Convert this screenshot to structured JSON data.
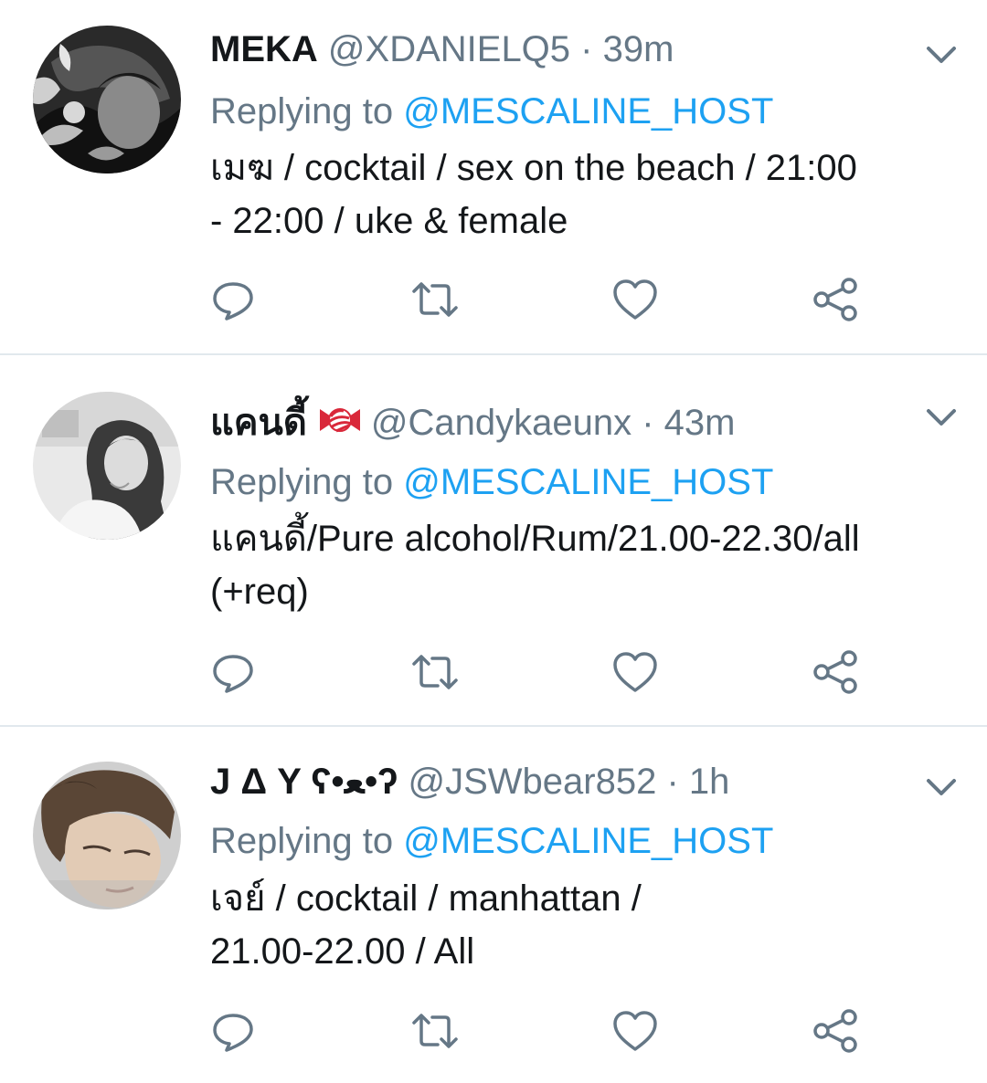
{
  "tweets": [
    {
      "display_name": "MEKA",
      "handle": "@XDANIELQ5",
      "separator": "·",
      "time": "39m",
      "replying_prefix": "Replying to",
      "replying_to": "@MESCALINE_HOST",
      "text_lines": [
        "เมฆ / cocktail / sex on the beach / 21:00",
        "- 22:00 / uke & female"
      ],
      "avatar_icon": "avatar-photo-dark"
    },
    {
      "display_name": "แคนดี้",
      "emoji_icon": "candy-icon",
      "handle": "@Candykaeunx",
      "separator": "·",
      "time": "43m",
      "replying_prefix": "Replying to",
      "replying_to": "@MESCALINE_HOST",
      "text_lines": [
        "แคนดี้/Pure alcohol/Rum/21.00-22.30/all",
        "(+req)"
      ],
      "avatar_icon": "avatar-photo-woman"
    },
    {
      "display_name": "J Δ Y ʕ•ﻌ•ʔ",
      "handle": "@JSWbear852",
      "separator": "·",
      "time": "1h",
      "replying_prefix": "Replying to",
      "replying_to": "@MESCALINE_HOST",
      "text_lines": [
        "เจย์ / cocktail / manhattan /",
        "21.00-22.00 / All"
      ],
      "avatar_icon": "avatar-photo-man"
    }
  ],
  "actions": [
    "reply-icon",
    "retweet-icon",
    "like-icon",
    "share-icon"
  ],
  "colors": {
    "text": "#14171a",
    "secondary": "#657786",
    "link": "#1da1f2",
    "icon": "#657786",
    "divider": "#e1e8ed"
  }
}
